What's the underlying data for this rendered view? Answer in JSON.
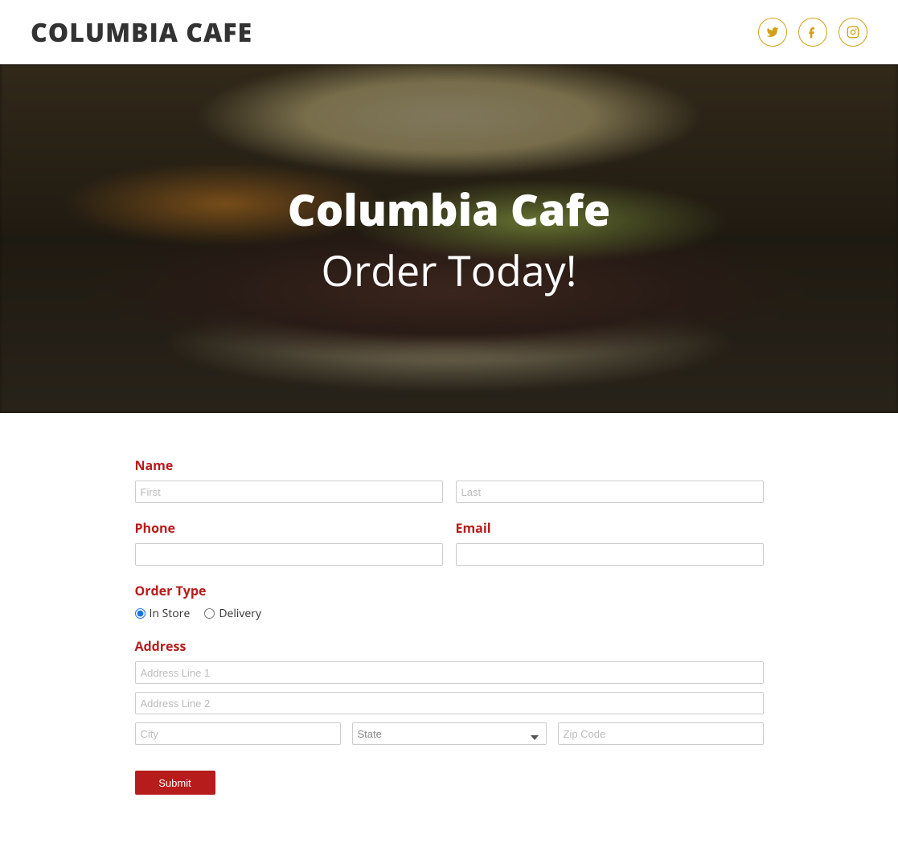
{
  "header": {
    "brand": "COLUMBIA CAFE",
    "socials": [
      "twitter",
      "facebook",
      "instagram"
    ]
  },
  "hero": {
    "title": "Columbia Cafe",
    "subtitle": "Order Today!"
  },
  "form": {
    "name_label": "Name",
    "first_ph": "First",
    "last_ph": "Last",
    "phone_label": "Phone",
    "email_label": "Email",
    "order_type_label": "Order Type",
    "order_type_options": {
      "in_store": "In Store",
      "delivery": "Delivery"
    },
    "order_type_selected": "in_store",
    "address_label": "Address",
    "addr1_ph": "Address Line 1",
    "addr2_ph": "Address Line 2",
    "city_ph": "City",
    "state_ph": "State",
    "zip_ph": "Zip Code",
    "submit_label": "Submit"
  }
}
